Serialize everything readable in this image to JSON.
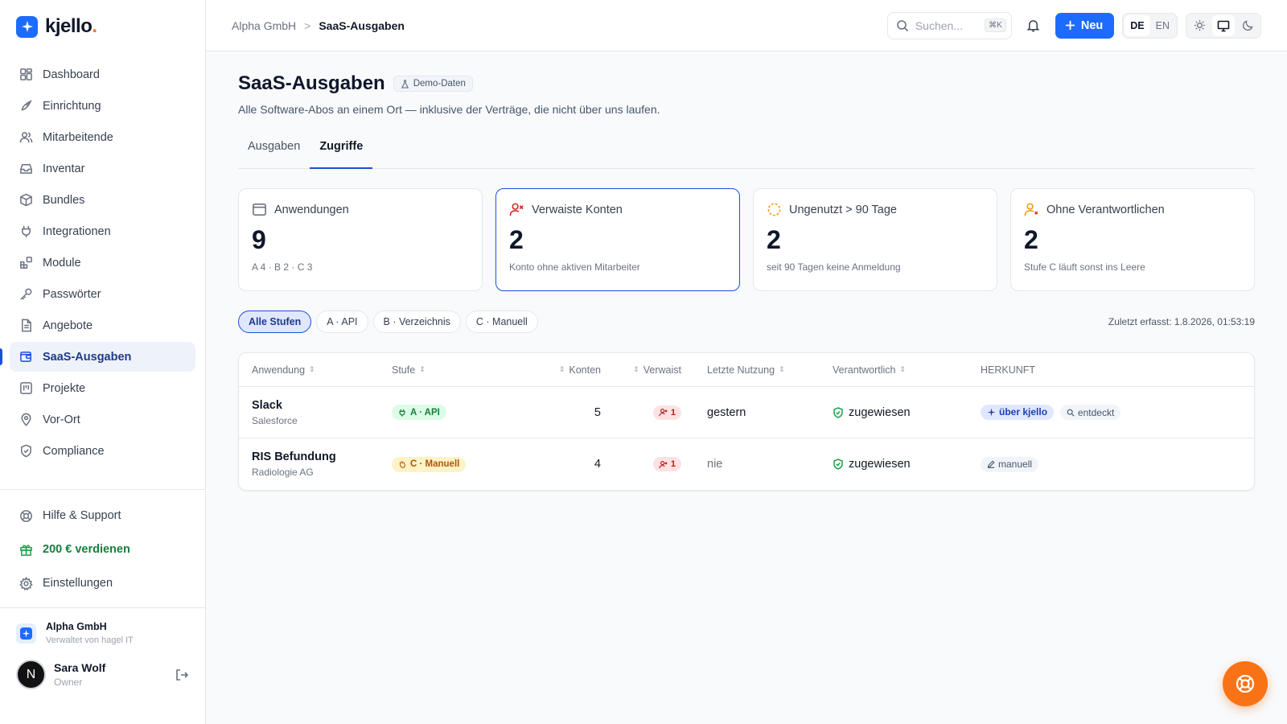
{
  "brand": {
    "name": "kjello",
    "dot": ".",
    "accent": "#1d6bff",
    "dot_color": "#f97316"
  },
  "sidebar": {
    "items": [
      {
        "label": "Dashboard",
        "icon": "grid-icon"
      },
      {
        "label": "Einrichtung",
        "icon": "rocket-icon"
      },
      {
        "label": "Mitarbeitende",
        "icon": "users-icon"
      },
      {
        "label": "Inventar",
        "icon": "inbox-icon"
      },
      {
        "label": "Bundles",
        "icon": "box-icon"
      },
      {
        "label": "Integrationen",
        "icon": "plug-icon"
      },
      {
        "label": "Module",
        "icon": "blocks-icon"
      },
      {
        "label": "Passwörter",
        "icon": "key-icon"
      },
      {
        "label": "Angebote",
        "icon": "document-icon"
      },
      {
        "label": "SaaS-Ausgaben",
        "icon": "wallet-icon",
        "active": true
      },
      {
        "label": "Projekte",
        "icon": "kanban-icon"
      },
      {
        "label": "Vor-Ort",
        "icon": "location-icon"
      },
      {
        "label": "Compliance",
        "icon": "shield-icon"
      }
    ],
    "bottom": {
      "help": "Hilfe & Support",
      "earn": "200 € verdienen",
      "settings": "Einstellungen"
    },
    "org": {
      "name": "Alpha GmbH",
      "sub": "Verwaltet von hagel IT"
    },
    "user": {
      "initial": "N",
      "name": "Sara Wolf",
      "role": "Owner"
    }
  },
  "topbar": {
    "breadcrumb": {
      "parent": "Alpha GmbH",
      "separator": ">",
      "current": "SaaS-Ausgaben"
    },
    "search_placeholder": "Suchen...",
    "shortcut": "⌘K",
    "new_label": "Neu",
    "lang": {
      "de": "DE",
      "en": "EN",
      "selected": "DE"
    },
    "theme_selected": "system"
  },
  "page": {
    "title": "SaaS-Ausgaben",
    "badge": "Demo-Daten",
    "subtitle": "Alle Software-Abos an einem Ort — inklusive der Verträge, die nicht über uns laufen.",
    "tabs": [
      {
        "label": "Ausgaben"
      },
      {
        "label": "Zugriffe",
        "active": true
      }
    ]
  },
  "cards": [
    {
      "title": "Anwendungen",
      "value": "9",
      "note": "A 4 · B 2 · C 3",
      "icon": "window-icon"
    },
    {
      "title": "Verwaiste Konten",
      "value": "2",
      "note": "Konto ohne aktiven Mitarbeiter",
      "icon": "user-x-icon",
      "selected": true
    },
    {
      "title": "Ungenutzt > 90 Tage",
      "value": "2",
      "note": "seit 90 Tagen keine Anmeldung",
      "icon": "dashed-circle-icon"
    },
    {
      "title": "Ohne Verantwortlichen",
      "value": "2",
      "note": "Stufe C läuft sonst ins Leere",
      "icon": "user-warning-icon"
    }
  ],
  "filters": {
    "chips": [
      {
        "label": "Alle Stufen",
        "active": true
      },
      {
        "label": "A · API"
      },
      {
        "label": "B · Verzeichnis"
      },
      {
        "label": "C · Manuell"
      }
    ],
    "last_captured": "Zuletzt erfasst: 1.8.2026, 01:53:19"
  },
  "table": {
    "headers": {
      "app": "Anwendung",
      "stufe": "Stufe",
      "konten": "Konten",
      "verwaist": "Verwaist",
      "nutzung": "Letzte Nutzung",
      "verantwortlich": "Verantwortlich",
      "herkunft": "HERKUNFT"
    },
    "rows": [
      {
        "name": "Slack",
        "vendor": "Salesforce",
        "tier": "A · API",
        "tier_kind": "a",
        "accounts": "5",
        "orphaned": "1",
        "last_usage": "gestern",
        "owner": "zugewiesen",
        "sources": [
          "über kjello",
          "entdeckt"
        ]
      },
      {
        "name": "RIS Befundung",
        "vendor": "Radiologie AG",
        "tier": "C · Manuell",
        "tier_kind": "c",
        "accounts": "4",
        "orphaned": "1",
        "last_usage": "nie",
        "owner": "zugewiesen",
        "sources": [
          "manuell"
        ]
      }
    ]
  },
  "fab": {
    "icon": "lifebuoy-icon",
    "color": "#f97316"
  }
}
